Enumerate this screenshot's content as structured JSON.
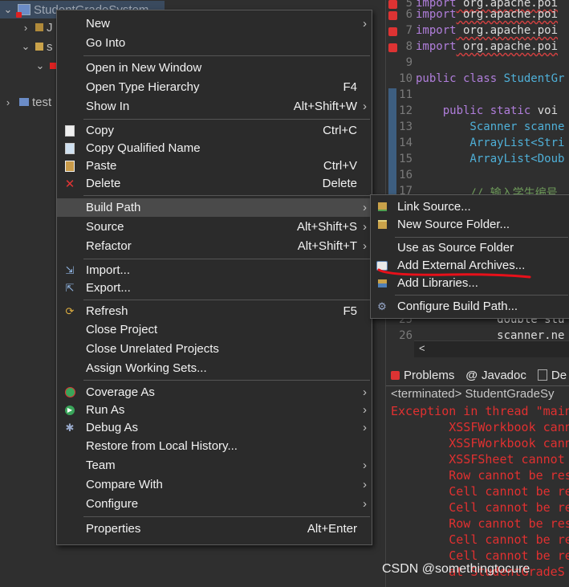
{
  "explorer": {
    "project_name": "StudentGradeSystem",
    "row_j": "J",
    "row_s": "s",
    "row_test": "test"
  },
  "editor": {
    "lines": [
      {
        "n": "5",
        "kw": "import",
        "rest": " org.apache.poi"
      },
      {
        "n": "6",
        "kw": "import",
        "rest": " org.apache.poi"
      },
      {
        "n": "7",
        "kw": "import",
        "rest": " org.apache.poi"
      },
      {
        "n": "8",
        "kw": "import",
        "rest": " org.apache.poi"
      },
      {
        "n": "9",
        "kw": "",
        "rest": ""
      },
      {
        "n": "10",
        "kw": "public class",
        "rest": " StudentGr"
      },
      {
        "n": "11",
        "kw": "",
        "rest": ""
      },
      {
        "n": "12",
        "kw": "    public static",
        "rest": " voi"
      },
      {
        "n": "13",
        "kw": "",
        "rest": "        Scanner scanne"
      },
      {
        "n": "14",
        "kw": "",
        "rest": "        ArrayList<Stri"
      },
      {
        "n": "15",
        "kw": "",
        "rest": "        ArrayList<Doub"
      },
      {
        "n": "16",
        "kw": "",
        "rest": ""
      },
      {
        "n": "17",
        "kw": "",
        "rest": "        // 输入学生编号"
      },
      {
        "n": "25",
        "kw": "",
        "rest": "            double stu"
      },
      {
        "n": "26",
        "kw": "",
        "rest": "            scanner.ne"
      }
    ]
  },
  "console": {
    "tabs": [
      "Problems",
      "Javadoc",
      "De"
    ],
    "terminated": "<terminated> StudentGradeSy",
    "lines": [
      "Exception in thread \"main",
      "        XSSFWorkbook cann",
      "        XSSFWorkbook cann",
      "        XSSFSheet cannot ",
      "        Row cannot be res",
      "        Cell cannot be re",
      "        Cell cannot be re",
      "        Row cannot be res",
      "        Cell cannot be re",
      "        Cell cannot be re",
      "        at StudentGradeS"
    ]
  },
  "menu": {
    "new": "New",
    "go_into": "Go Into",
    "open_new_window": "Open in New Window",
    "open_type_hierarchy": "Open Type Hierarchy",
    "open_type_hierarchy_sc": "F4",
    "show_in": "Show In",
    "show_in_sc": "Alt+Shift+W",
    "copy": "Copy",
    "copy_sc": "Ctrl+C",
    "copy_qualified": "Copy Qualified Name",
    "paste": "Paste",
    "paste_sc": "Ctrl+V",
    "delete": "Delete",
    "delete_sc": "Delete",
    "build_path": "Build Path",
    "source": "Source",
    "source_sc": "Alt+Shift+S",
    "refactor": "Refactor",
    "refactor_sc": "Alt+Shift+T",
    "import": "Import...",
    "export": "Export...",
    "refresh": "Refresh",
    "refresh_sc": "F5",
    "close_project": "Close Project",
    "close_unrelated": "Close Unrelated Projects",
    "assign_working_sets": "Assign Working Sets...",
    "coverage_as": "Coverage As",
    "run_as": "Run As",
    "debug_as": "Debug As",
    "restore_history": "Restore from Local History...",
    "team": "Team",
    "compare_with": "Compare With",
    "configure": "Configure",
    "properties": "Properties",
    "properties_sc": "Alt+Enter"
  },
  "submenu": {
    "link_source": "Link Source...",
    "new_source_folder": "New Source Folder...",
    "use_as_source": "Use as Source Folder",
    "add_external_archives": "Add External Archives...",
    "add_libraries": "Add Libraries...",
    "configure_build_path": "Configure Build Path..."
  },
  "scroll_arrow": "<",
  "watermark": "CSDN @somethingtocure",
  "colors": {
    "annotation_red": "#e8101a",
    "menu_bg": "#2b2b2b",
    "highlight": "#4a4a4a"
  }
}
